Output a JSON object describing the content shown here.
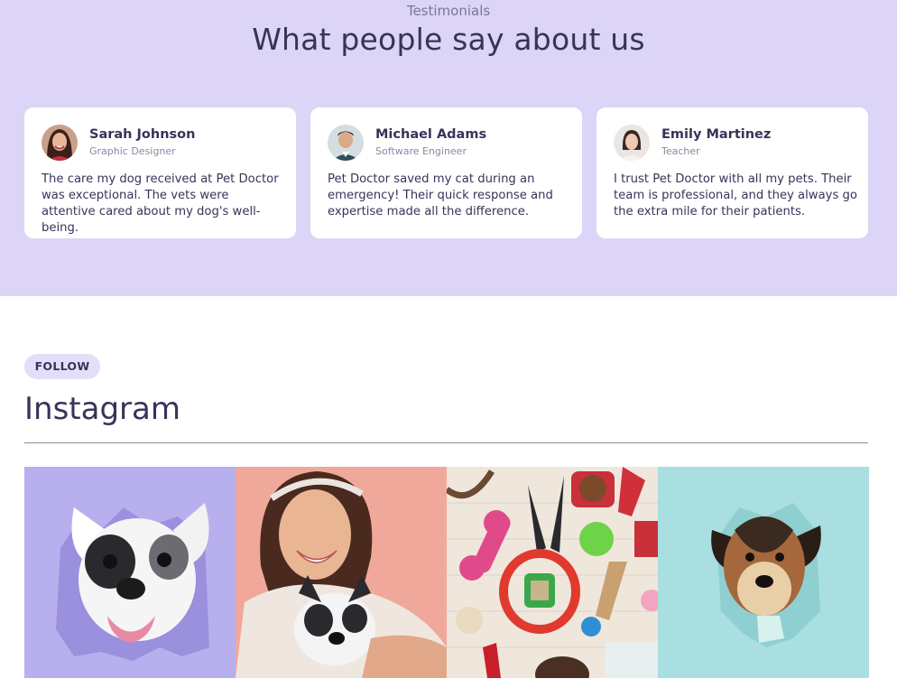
{
  "testimonials": {
    "eyebrow": "Testimonials",
    "title": "What people say about us",
    "cards": [
      {
        "name": "Sarah Johnson",
        "role": "Graphic Designer",
        "quote": "The care my dog received at Pet Doctor was exceptional. The vets were attentive cared about my dog's well-being."
      },
      {
        "name": "Michael Adams",
        "role": "Software Engineer",
        "quote": "Pet Doctor saved my cat during an emergency! Their quick response and expertise made all the difference."
      },
      {
        "name": "Emily Martinez",
        "role": "Teacher",
        "quote": "I trust Pet Doctor with all my pets. Their team is professional, and they always go the extra mile for their patients."
      }
    ]
  },
  "instagram": {
    "pill": "FOLLOW",
    "title": "Instagram",
    "photos": [
      {
        "icon": "french-bulldog-photo",
        "bg": "#b8b0ee"
      },
      {
        "icon": "woman-with-dog-photo",
        "bg": "#f0a89a"
      },
      {
        "icon": "pet-toys-photo",
        "bg": "#efe6dc"
      },
      {
        "icon": "dog-through-paper-photo",
        "bg": "#a9dfe0"
      }
    ]
  },
  "colors": {
    "testimonials_bg": "#dcd5f7",
    "heading": "#37345a",
    "pill_bg": "#e4dff8"
  }
}
